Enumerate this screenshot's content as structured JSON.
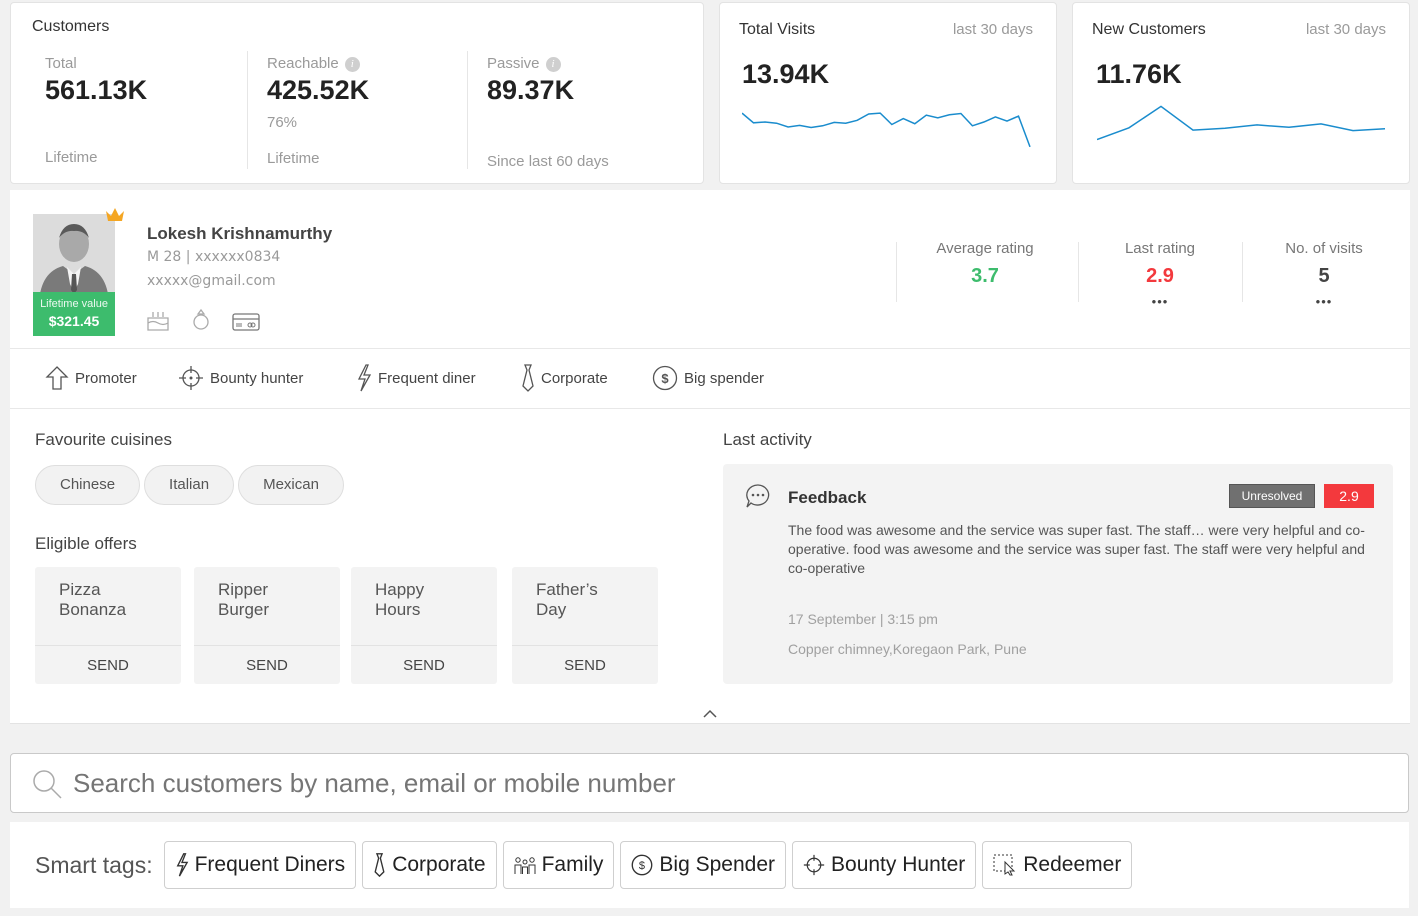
{
  "customers": {
    "title": "Customers",
    "total": {
      "label": "Total",
      "value": "561.13K",
      "foot": "Lifetime"
    },
    "reachable": {
      "label": "Reachable",
      "value": "425.52K",
      "pct": "76%",
      "foot": "Lifetime"
    },
    "passive": {
      "label": "Passive",
      "value": "89.37K",
      "foot": "Since last 60 days"
    }
  },
  "total_visits": {
    "title": "Total Visits",
    "period": "last 30 days",
    "value": "13.94K"
  },
  "new_customers": {
    "title": "New Customers",
    "period": "last 30 days",
    "value": "11.76K"
  },
  "profile": {
    "name": "Lokesh Krishnamurthy",
    "meta": "M 28 | xxxxxx0834",
    "email": "xxxxx@gmail.com",
    "lifetime_label": "Lifetime value",
    "lifetime_value": "$321.45",
    "stats": {
      "avg_label": "Average rating",
      "avg_value": "3.7",
      "last_label": "Last rating",
      "last_value": "2.9",
      "visits_label": "No. of visits",
      "visits_value": "5",
      "more": "•••"
    },
    "badges": [
      "Promoter",
      "Bounty hunter",
      "Frequent diner",
      "Corporate",
      "Big spender"
    ]
  },
  "cuisines": {
    "title": "Favourite cuisines",
    "items": [
      "Chinese",
      "Italian",
      "Mexican"
    ]
  },
  "offers": {
    "title": "Eligible offers",
    "send_label": "SEND",
    "items": [
      {
        "line1": "Pizza",
        "line2": "Bonanza"
      },
      {
        "line1": "Ripper",
        "line2": "Burger"
      },
      {
        "line1": "Happy",
        "line2": "Hours"
      },
      {
        "line1": "Father’s",
        "line2": "Day"
      }
    ]
  },
  "activity": {
    "title": "Last activity",
    "type": "Feedback",
    "status": "Unresolved",
    "rating": "2.9",
    "text": "The food was awesome and the service was super fast. The staff… were very helpful and co-operative. food was awesome and the service was super fast. The staff were very helpful and co-operative",
    "date": "17 September | 3:15 pm",
    "location": "Copper chimney,Koregaon Park, Pune"
  },
  "search": {
    "placeholder": "Search customers by name, email or mobile number"
  },
  "smart_tags": {
    "label": "Smart tags:",
    "items": [
      "Frequent Diners",
      "Corporate",
      "Family",
      "Big Spender",
      "Bounty Hunter",
      "Redeemer"
    ]
  },
  "colors": {
    "green": "#3dbc6d",
    "red": "#f3393d",
    "accent_blue": "#1a8ccd",
    "crown": "#f4a623",
    "unresolved": "#707070"
  },
  "sparklines": {
    "total_visits": [
      12.5,
      10.2,
      10.4,
      10.1,
      9.2,
      9.6,
      9.1,
      9.5,
      10.3,
      10.1,
      10.8,
      12.3,
      12.5,
      9.8,
      11.2,
      10.0,
      12.0,
      11.4,
      12.1,
      12.4,
      9.5,
      10.4,
      11.6,
      10.6,
      11.8,
      4.5
    ],
    "new_customers": [
      10.0,
      15.0,
      24.0,
      14.0,
      14.8,
      16.2,
      15.2,
      16.6,
      13.8,
      14.6
    ]
  }
}
